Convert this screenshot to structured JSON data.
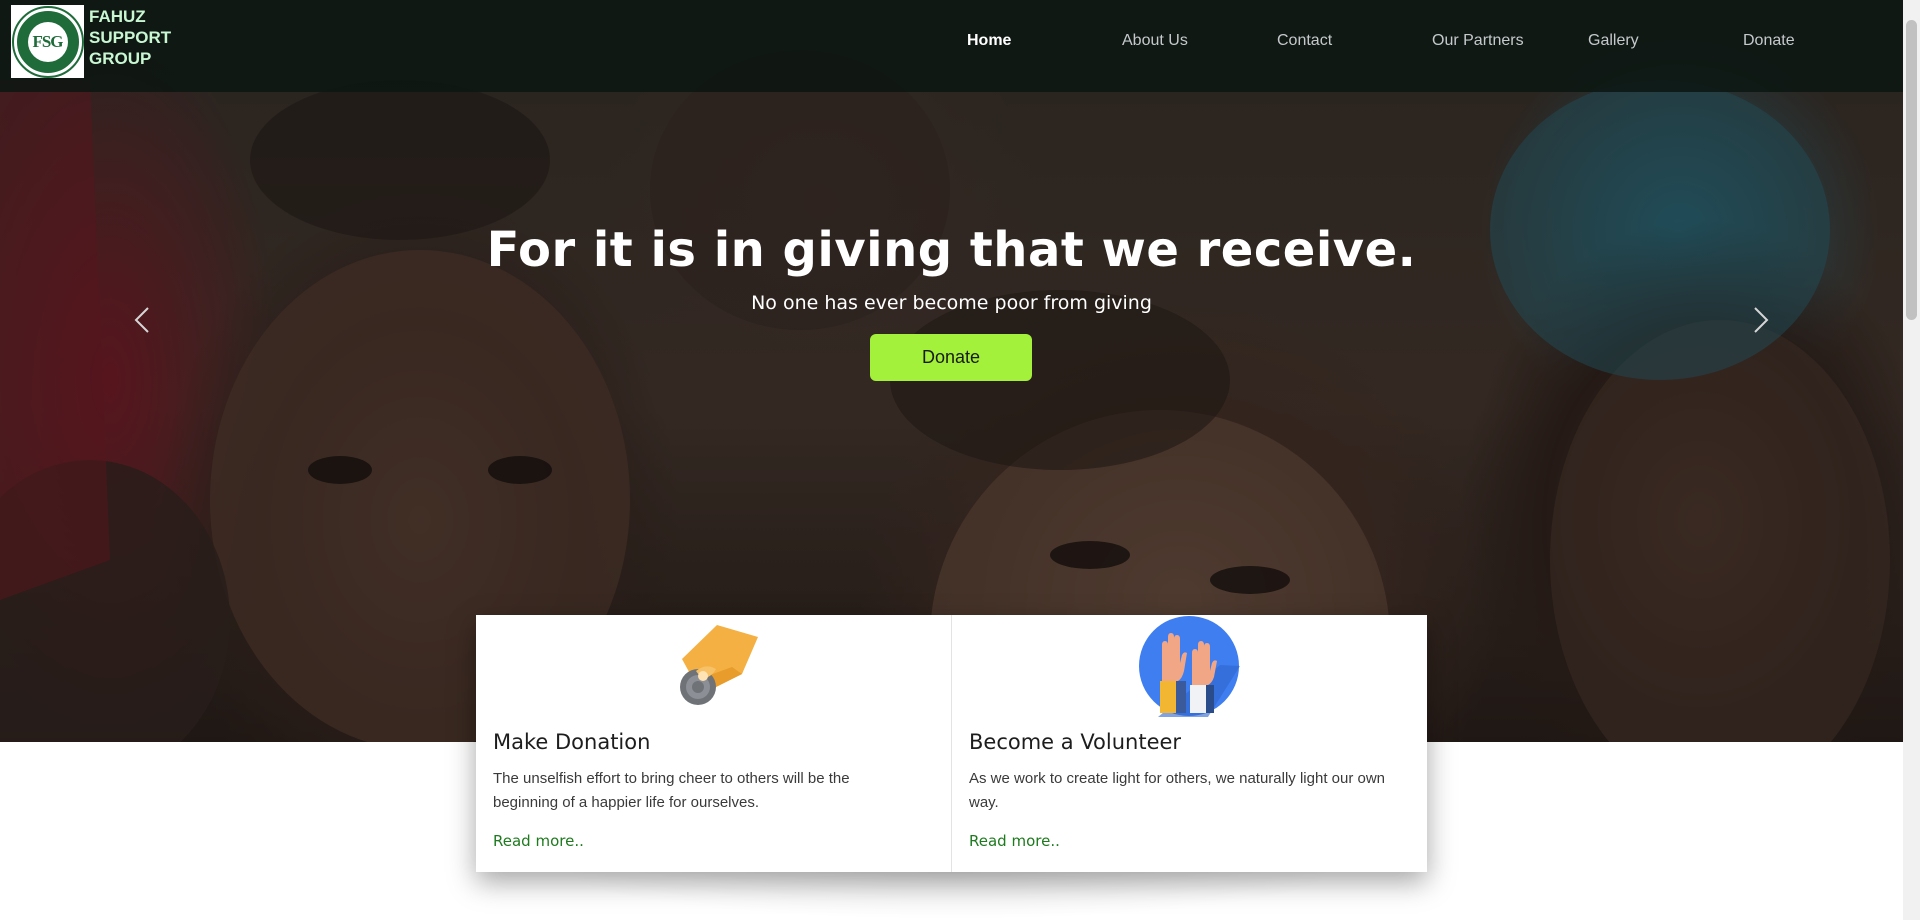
{
  "brand": {
    "logo_mark": "FSG",
    "logo_ring_text": "FAHUZ SUPPORT GROUP",
    "name_line1": "FAHUZ",
    "name_line2": "SUPPORT",
    "name_line3": "GROUP"
  },
  "nav": {
    "items": [
      {
        "label": "Home",
        "active": true
      },
      {
        "label": "About Us"
      },
      {
        "label": "Contact"
      },
      {
        "label": "Our Partners"
      },
      {
        "label": "Gallery"
      },
      {
        "label": "Donate"
      }
    ]
  },
  "hero": {
    "title": "For it is in giving that we receive.",
    "subtitle": "No one has ever become poor from giving",
    "button_label": "Donate",
    "prev_icon": "chevron-left-icon",
    "next_icon": "chevron-right-icon"
  },
  "cards": [
    {
      "icon": "hand-coin-icon",
      "title": "Make Donation",
      "text": "The unselfish effort to bring cheer to others will be the beginning of a happier life for ourselves.",
      "link": "Read more.."
    },
    {
      "icon": "raised-hands-icon",
      "title": "Become a Volunteer",
      "text": "As we work to create light for others, we naturally light our own way.",
      "link": "Read more.."
    }
  ],
  "colors": {
    "accent_green": "#a3f13a",
    "link_green": "#1e7a1e",
    "brand_text": "#c8f7d2",
    "navbar_bg": "#0c1612"
  }
}
